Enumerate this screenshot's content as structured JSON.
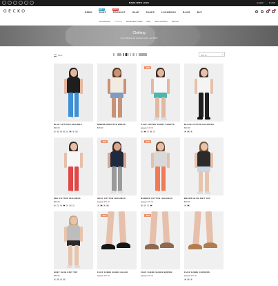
{
  "topbar": {
    "promo": "MADE WITH LOVE",
    "lang": "English",
    "currency": "$ USD"
  },
  "header": {
    "logo": "GECKO",
    "nav": [
      {
        "label": "DEMO",
        "badge": ""
      },
      {
        "label": "SHOP",
        "badge": "HOT",
        "badge_color": "#3aa7c8"
      },
      {
        "label": "PRODUCT",
        "badge": "NEW",
        "badge_color": "#e04747"
      },
      {
        "label": "SALE",
        "badge": ""
      },
      {
        "label": "PAGES",
        "badge": ""
      },
      {
        "label": "LOOKBOOK",
        "badge": ""
      },
      {
        "label": "BLOG",
        "badge": ""
      },
      {
        "label": "BUY",
        "badge": ""
      }
    ]
  },
  "categories": [
    "Accessories",
    "Clothing",
    "Handmade Crafts",
    "Men",
    "Shoe Fashion",
    "Women"
  ],
  "hero": {
    "title": "Clothing",
    "subtitle": "Free Shipping for standard order over $100"
  },
  "toolbar": {
    "filter_label": "Filter",
    "sort_label": "Sort by"
  },
  "products": [
    {
      "name": "BLUE COTTON LEGGINGS",
      "old": "",
      "price": "$30.00",
      "sale": "",
      "swatches": [
        "#4aa3df",
        "#b7b7b7",
        "#444444",
        "#c9a5d6",
        "#e7b5c0",
        "#8a5b3c",
        "#6ea85b",
        "#f1c24b"
      ]
    },
    {
      "name": "RIBBED MOCKTAN DRESS",
      "old": "",
      "price": "$35.00",
      "sale": "",
      "swatches": []
    },
    {
      "name": "CYAN COFFEE SHORT SHORTS",
      "old": "$60.00",
      "price": "$45.00",
      "sale": "-25%",
      "swatches": [
        "#4db6ac",
        "#333333",
        "#e0e0e0",
        "#b58c5e",
        "#f2c4cf"
      ]
    },
    {
      "name": "BLACK COTTON LEGGINGS",
      "old": "",
      "price": "$30.00",
      "sale": "",
      "swatches": [
        "#222222",
        "#e04747",
        "#c04040"
      ]
    },
    {
      "name": "RED COTTON LEGGINGS",
      "old": "",
      "price": "$30.00",
      "sale": "",
      "swatches": [
        "#e04747",
        "#e6e6e6",
        "#555555",
        "#222222",
        "#c9a5d6",
        "#9ad0e6",
        "#f5d36b"
      ]
    },
    {
      "name": "GREY COTTON LEGGINGS",
      "old": "$40.00",
      "price": "$30.00",
      "sale": "-25%",
      "swatches": [
        "#888888",
        "#333333",
        "#e04747",
        "#4aa3df"
      ]
    },
    {
      "name": "MODERN COTTON LEGGINGS",
      "old": "$40.00",
      "price": "$30.00",
      "sale": "-25%",
      "swatches": [
        "#e04747",
        "#f6b0a0",
        "#cccccc",
        "#333333"
      ]
    },
    {
      "name": "BROWN SLUB KNIT TOP",
      "old": "",
      "price": "$30.00",
      "sale": "",
      "swatches": [
        "#e04747",
        "#333333"
      ]
    },
    {
      "name": "GREY SLUB KNIT TOP",
      "old": "",
      "price": "$30.00",
      "sale": "",
      "swatches": [
        "#8e8e8e",
        "#7bb3d9",
        "#cc4b4b",
        "#c7a95a"
      ]
    },
    {
      "name": "FAUX SUEDE SHOES BLACK",
      "old": "$40.00",
      "price": "$30.00",
      "sale": "-25%",
      "swatches": []
    },
    {
      "name": "FAUX SUEDE SHOES BROWN",
      "old": "$40.00",
      "price": "$30.00",
      "sale": "-25%",
      "swatches": []
    },
    {
      "name": "FAUX SUEDE OXFORDS",
      "old": "$40.00",
      "price": "$30.00",
      "sale": "",
      "swatches": [
        "#333333",
        "#c48a5a",
        "#e04747"
      ]
    }
  ]
}
